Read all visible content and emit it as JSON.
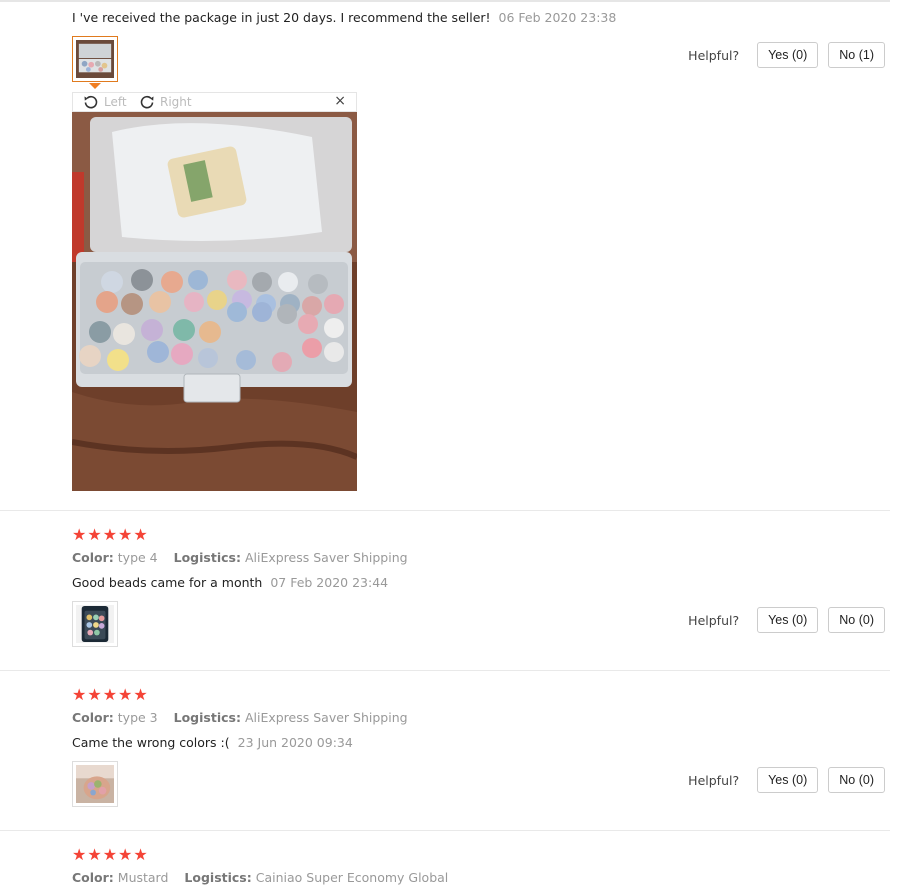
{
  "reviews": [
    {
      "text": "I 've received the package in just 20 days. I recommend the seller!",
      "date": "06 Feb 2020 23:38",
      "helpful_label": "Helpful?",
      "yes_label": "Yes (0)",
      "no_label": "No (1)"
    },
    {
      "stars": "★★★★★",
      "color_label": "Color:",
      "color_value": "type 4",
      "logistics_label": "Logistics:",
      "logistics_value": "AliExpress Saver Shipping",
      "text": "Good beads came for a month",
      "date": "07 Feb 2020 23:44",
      "helpful_label": "Helpful?",
      "yes_label": "Yes (0)",
      "no_label": "No (0)"
    },
    {
      "stars": "★★★★★",
      "color_label": "Color:",
      "color_value": "type 3",
      "logistics_label": "Logistics:",
      "logistics_value": "AliExpress Saver Shipping",
      "text": "Came the wrong colors :(",
      "date": "23 Jun 2020 09:34",
      "helpful_label": "Helpful?",
      "yes_label": "Yes (0)",
      "no_label": "No (0)"
    },
    {
      "stars": "★★★★★",
      "color_label": "Color:",
      "color_value": "Mustard",
      "logistics_label": "Logistics:",
      "logistics_value": "Cainiao Super Economy Global"
    }
  ],
  "viewer": {
    "rotate_left_label": "Left",
    "rotate_right_label": "Right",
    "close_label": "×",
    "rotate_left_icon": "rotate-left-icon",
    "rotate_right_icon": "rotate-right-icon"
  },
  "colors": {
    "star": "#f44336",
    "active_thumb_border": "#e07a1e",
    "muted_text": "#999999"
  }
}
